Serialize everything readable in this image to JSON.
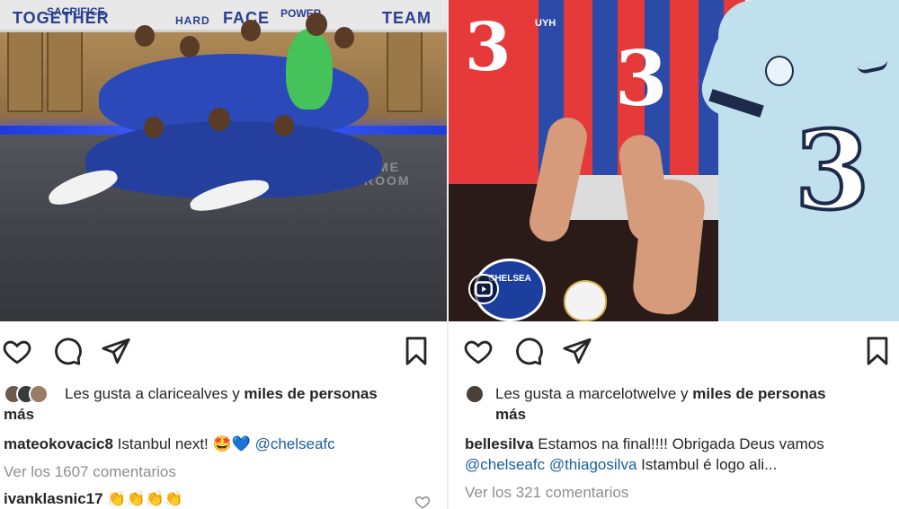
{
  "left_post": {
    "photo": {
      "banner_words": [
        "TOGETHER",
        "HARD",
        "FACE",
        "TEAM"
      ],
      "banner_small": [
        "SACRIFICE",
        "POWER"
      ],
      "floor_text": "HOME",
      "floor_text_2": "ROOM"
    },
    "likes": {
      "prefix": "Les gusta a",
      "user": "claricealves",
      "connector": "y",
      "rest": "miles de personas",
      "rest_line2": "más"
    },
    "caption": {
      "user": "mateokovacic8",
      "text": "Istanbul next!",
      "emoji": "🤩💙",
      "mention": "@chelseafc"
    },
    "view_comments": "Ver los 1607 comentarios",
    "comment": {
      "user": "ivanklasnic17",
      "text": "👏👏👏👏"
    }
  },
  "right_post": {
    "photo": {
      "sponsor_mark": "3",
      "chelsea_badge": "CHELSEA",
      "shirt_text": "UYH"
    },
    "likes": {
      "prefix": "Les gusta a",
      "user": "marcelotwelve",
      "connector": "y",
      "rest": "miles de personas",
      "rest_line2": "más"
    },
    "caption": {
      "user": "bellesilva",
      "text": "Estamos na final!!!! Obrigada Deus vamos",
      "mention1": "@chelseafc",
      "mention2": "@thiagosilva",
      "text2": "Istambul é logo ali..."
    },
    "view_comments": "Ver los 321 comentarios"
  },
  "icons": {
    "like": "heart-icon",
    "comment": "comment-bubble-icon",
    "share": "paper-plane-icon",
    "save": "bookmark-icon"
  },
  "colors": {
    "text": "#262626",
    "muted": "#8e8e8e",
    "mention": "#1b5fa0",
    "chelsea_blue": "#1c3f9e",
    "led_blue": "#3f5cff",
    "red_shirt": "#e63a3a"
  }
}
